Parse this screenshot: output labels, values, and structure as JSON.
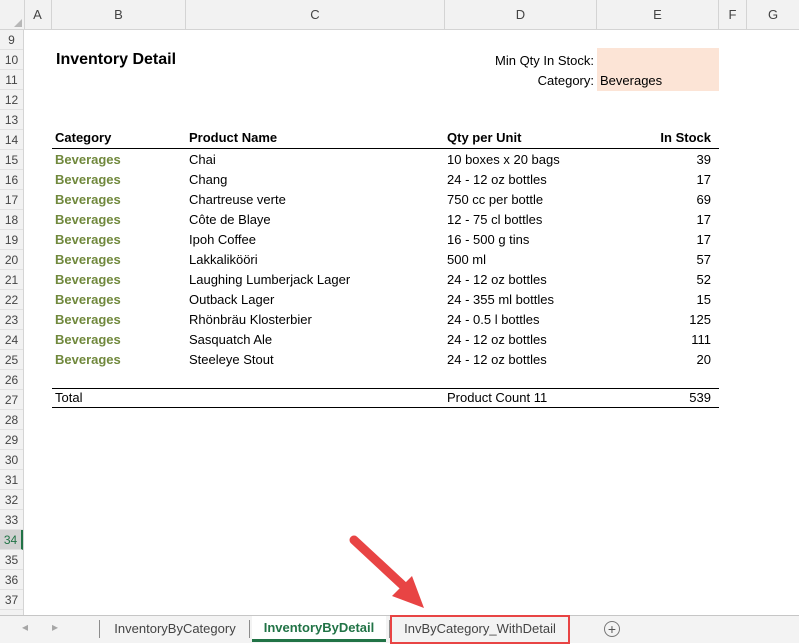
{
  "columns": [
    "A",
    "B",
    "C",
    "D",
    "E",
    "F",
    "G"
  ],
  "rows": [
    "9",
    "10",
    "11",
    "12",
    "13",
    "14",
    "15",
    "16",
    "17",
    "18",
    "19",
    "20",
    "21",
    "22",
    "23",
    "24",
    "25",
    "26",
    "27",
    "28",
    "29",
    "30",
    "31",
    "32",
    "33",
    "34",
    "35",
    "36",
    "37"
  ],
  "selected_row": "34",
  "report": {
    "title": "Inventory Detail",
    "min_qty_label": "Min Qty In Stock:",
    "min_qty_value": "",
    "category_label": "Category:",
    "category_value": "Beverages"
  },
  "table": {
    "headers": [
      "Category",
      "Product Name",
      "Qty per Unit",
      "In Stock"
    ],
    "rows": [
      [
        "Beverages",
        "Chai",
        "10 boxes x 20 bags",
        "39"
      ],
      [
        "Beverages",
        "Chang",
        "24 - 12 oz bottles",
        "17"
      ],
      [
        "Beverages",
        "Chartreuse verte",
        "750 cc per bottle",
        "69"
      ],
      [
        "Beverages",
        "Côte de Blaye",
        "12 - 75 cl bottles",
        "17"
      ],
      [
        "Beverages",
        "Ipoh Coffee",
        "16 - 500 g tins",
        "17"
      ],
      [
        "Beverages",
        "Lakkalikööri",
        "500 ml",
        "57"
      ],
      [
        "Beverages",
        "Laughing Lumberjack Lager",
        "24 - 12 oz bottles",
        "52"
      ],
      [
        "Beverages",
        "Outback Lager",
        "24 - 355 ml bottles",
        "15"
      ],
      [
        "Beverages",
        "Rhönbräu Klosterbier",
        "24 - 0.5 l bottles",
        "125"
      ],
      [
        "Beverages",
        "Sasquatch Ale",
        "24 - 12 oz bottles",
        "111"
      ],
      [
        "Beverages",
        "Steeleye Stout",
        "24 - 12 oz bottles",
        "20"
      ]
    ],
    "total_label": "Total",
    "product_count": "Product Count 11",
    "total_stock": "539"
  },
  "sheet_tabs": [
    {
      "label": "InventoryByCategory",
      "active": false
    },
    {
      "label": "InventoryByDetail",
      "active": true
    },
    {
      "label": "InvByCategory_WithDetail",
      "active": false
    }
  ],
  "icons": {
    "nav_prev": "left-arrow-icon",
    "nav_next": "right-arrow-icon",
    "new_sheet": "plus-circle-icon",
    "annotation": "red-arrow-icon"
  },
  "colors": {
    "accent": "#217346",
    "category_text": "#70883c",
    "input_fill": "#fce4d6",
    "annotation": "#e84444"
  }
}
